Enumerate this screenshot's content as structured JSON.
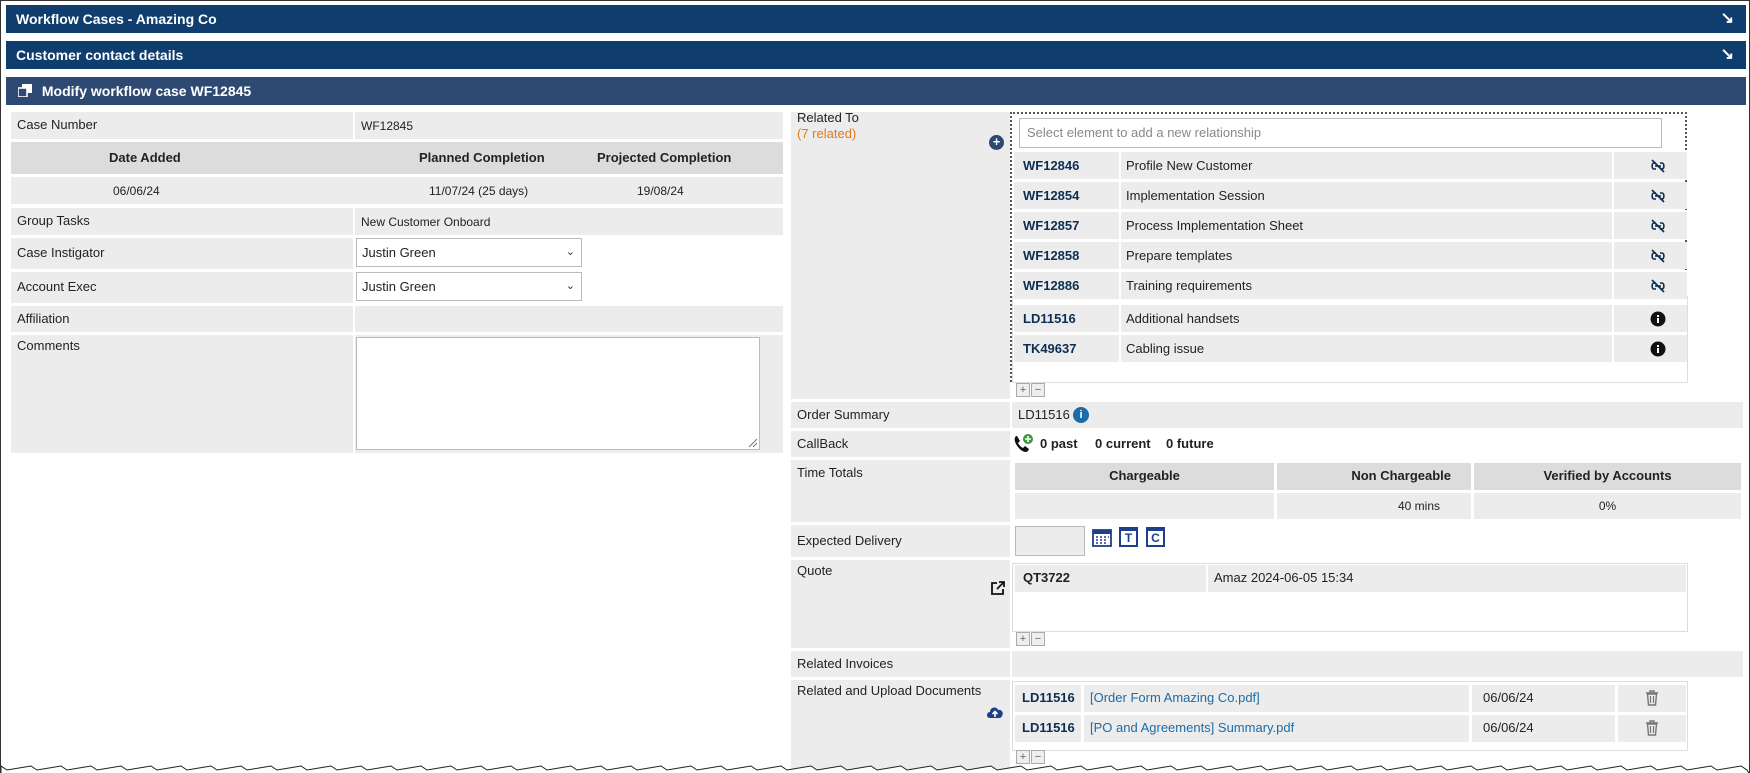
{
  "bars": {
    "workflow": "Workflow Cases - Amazing Co",
    "contact": "Customer contact details",
    "modify": "Modify workflow case WF12845"
  },
  "left": {
    "case_number_label": "Case Number",
    "case_number": "WF12845",
    "date_added_label": "Date Added",
    "planned_label": "Planned Completion",
    "projected_label": "Projected Completion",
    "date_added": "06/06/24",
    "planned": "11/07/24 (25 days)",
    "projected": "19/08/24",
    "group_tasks_label": "Group Tasks",
    "group_tasks": "New Customer Onboard",
    "instigator_label": "Case Instigator",
    "instigator": "Justin Green",
    "account_exec_label": "Account Exec",
    "account_exec": "Justin Green",
    "affiliation_label": "Affiliation",
    "comments_label": "Comments"
  },
  "right": {
    "related_to_label": "Related To",
    "related_count": "(7 related)",
    "relationship_placeholder": "Select element to add a new relationship",
    "related_items": [
      {
        "id": "WF12846",
        "desc": "Profile New Customer"
      },
      {
        "id": "WF12854",
        "desc": "Implementation Session"
      },
      {
        "id": "WF12857",
        "desc": "Process Implementation Sheet"
      },
      {
        "id": "WF12858",
        "desc": "Prepare templates"
      },
      {
        "id": "WF12886",
        "desc": "Training requirements"
      },
      {
        "id": "LD11516",
        "desc": "Additional handsets"
      },
      {
        "id": "TK49637",
        "desc": "Cabling issue"
      }
    ],
    "order_summary_label": "Order Summary",
    "order_summary": "LD11516",
    "callback_label": "CallBack",
    "callback_past": "0 past",
    "callback_current": "0 current",
    "callback_future": "0 future",
    "time_totals_label": "Time Totals",
    "chargeable_label": "Chargeable",
    "non_chargeable_label": "Non Chargeable",
    "verified_label": "Verified by Accounts",
    "chargeable": "",
    "non_chargeable": "40 mins",
    "verified": "0%",
    "expected_delivery_label": "Expected Delivery",
    "quote_label": "Quote",
    "quote_id": "QT3722",
    "quote_desc": "Amaz 2024-06-05 15:34",
    "related_invoices_label": "Related Invoices",
    "documents_label": "Related and Upload Documents",
    "documents": [
      {
        "id": "LD11516",
        "name": "[Order Form Amazing Co.pdf]",
        "date": "06/06/24"
      },
      {
        "id": "LD11516",
        "name": "[PO and Agreements] Summary.pdf",
        "date": "06/06/24"
      }
    ],
    "cal_t": "T",
    "cal_c": "C"
  },
  "colors": {
    "bar": "#0f3d6e",
    "bar_modify": "#2f4a72",
    "accent": "#e07b1a",
    "link": "#1b6ca8"
  }
}
